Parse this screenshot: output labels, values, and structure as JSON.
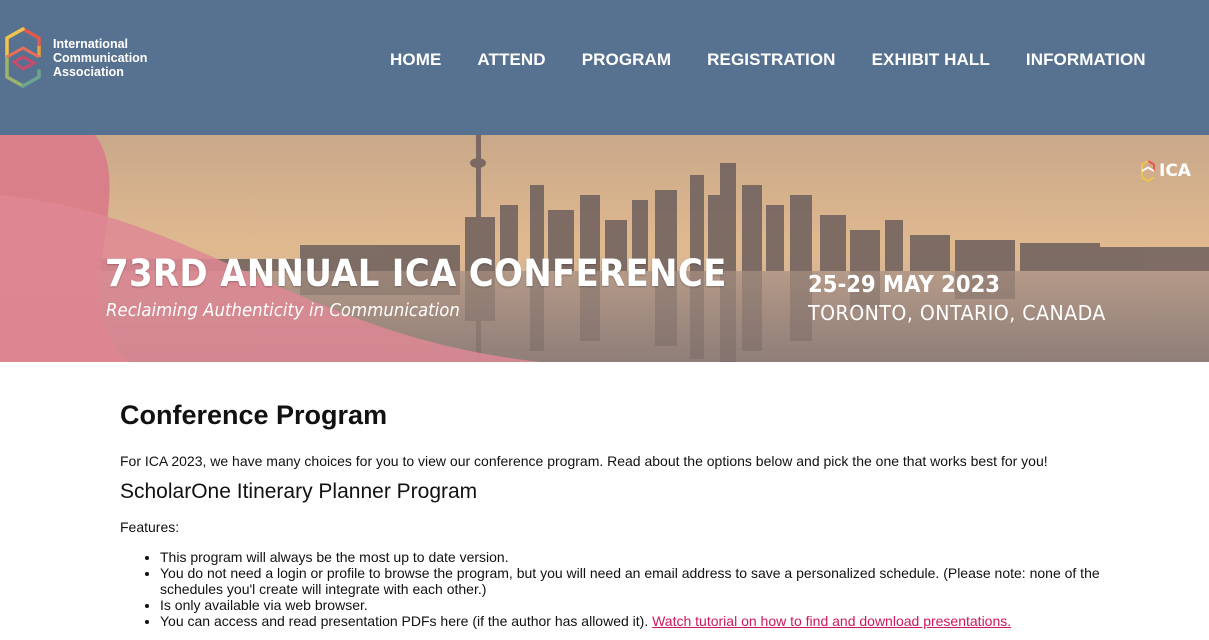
{
  "header": {
    "logo_lines": [
      "International",
      "Communication",
      "Association"
    ],
    "nav": [
      "HOME",
      "ATTEND",
      "PROGRAM",
      "REGISTRATION",
      "EXHIBIT HALL",
      "INFORMATION"
    ]
  },
  "banner": {
    "title": "73RD ANNUAL ICA CONFERENCE",
    "subtitle": "Reclaiming Authenticity in Communication",
    "dates": "25-29 MAY 2023",
    "location": "TORONTO, ONTARIO, CANADA",
    "badge": "ICA"
  },
  "main": {
    "heading": "Conference Program",
    "intro": "For ICA 2023, we have many choices for you to view our conference program. Read about the options below and pick the one that works best for you!",
    "section_title": "ScholarOne Itinerary Planner Program",
    "features_label": "Features:",
    "features": [
      "This program will always be the most up to date version.",
      "You do not need a login or profile to browse the program, but you will need an email address to save a personalized schedule. (Please note: none of the schedules you'l create will integrate with each other.)",
      "Is only available via web browser.",
      "You can access and read presentation PDFs here (if the author has allowed it). "
    ],
    "tutorial_link": "Watch tutorial on how to find and download presentations."
  },
  "colors": {
    "header_bg": "#577290",
    "link": "#d1155e",
    "banner_pink": "#d97a88"
  }
}
